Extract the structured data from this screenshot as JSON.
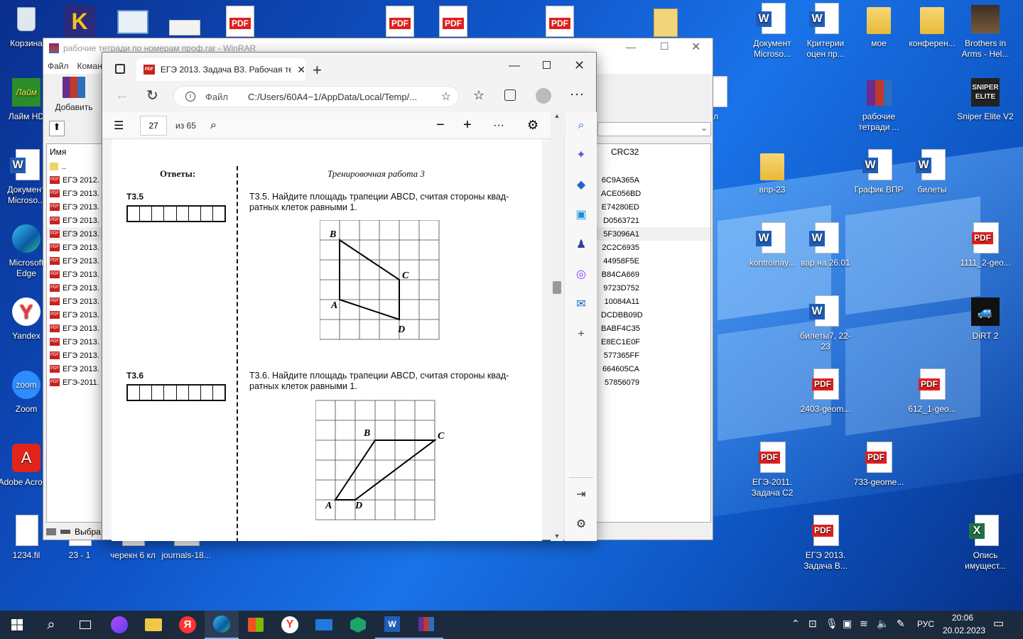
{
  "desktop_icons": [
    {
      "label": "Корзина",
      "type": "bin"
    },
    {
      "label": "Лайм HD",
      "type": "app",
      "color": "#2a8c2a",
      "text": "Лайм"
    },
    {
      "label": "Документ Microso...",
      "type": "word"
    },
    {
      "label": "Microsoft Edge",
      "type": "edge"
    },
    {
      "label": "Yandex",
      "type": "yandex"
    },
    {
      "label": "Zoom",
      "type": "zoom"
    },
    {
      "label": "Adobe Acrobat",
      "type": "acrobat"
    },
    {
      "label": "1234.fil",
      "type": "doc"
    },
    {
      "label": "23 - 1",
      "type": "doc"
    },
    {
      "label": "черекн 6 кл",
      "type": "doc"
    },
    {
      "label": "journals-18...",
      "type": "pdf"
    },
    {
      "label": "Документ Microso...",
      "type": "word"
    },
    {
      "label": "Критерии оцен пр...",
      "type": "word"
    },
    {
      "label": "мое",
      "type": "folder"
    },
    {
      "label": "конферен...",
      "type": "folder"
    },
    {
      "label": "Brothers in Arms - Hel...",
      "type": "game"
    },
    {
      "label": "кл",
      "type": "word"
    },
    {
      "label": "рабочие тетради ...",
      "type": "rar"
    },
    {
      "label": "Sniper Elite V2",
      "type": "sniper"
    },
    {
      "label": "впр-23",
      "type": "folder"
    },
    {
      "label": "График ВПР",
      "type": "word"
    },
    {
      "label": "билеты",
      "type": "word"
    },
    {
      "label": "kontrolnay...",
      "type": "word"
    },
    {
      "label": "вар на 26.01",
      "type": "word"
    },
    {
      "label": "1111_2-geo...",
      "type": "pdf"
    },
    {
      "label": "билеты7, 22-23",
      "type": "word"
    },
    {
      "label": "DiRT 2",
      "type": "dirt"
    },
    {
      "label": "2403-geom...",
      "type": "pdf"
    },
    {
      "label": "612_1-geo...",
      "type": "pdf"
    },
    {
      "label": "ЕГЭ-2011. Задача С2",
      "type": "pdf"
    },
    {
      "label": "733-geome...",
      "type": "pdf"
    },
    {
      "label": "ЕГЭ 2013. Задача В...",
      "type": "pdf"
    },
    {
      "label": "Опись имущест...",
      "type": "excel"
    }
  ],
  "top_icons": [
    "PDF",
    "PDF",
    "PDF",
    "PDF"
  ],
  "winrar": {
    "title": "рабочие тетради по номерам проф.rar - WinRAR",
    "menu": [
      "Файл",
      "Коман"
    ],
    "add_label": "Добавить",
    "col_name": "Имя",
    "col_crc": "CRC32",
    "status": "Выбра",
    "rows": [
      {
        "name": "..",
        "crc": ""
      },
      {
        "name": "ЕГЭ 2012.  3",
        "crc": "6C9A365A"
      },
      {
        "name": "ЕГЭ 2013.  3",
        "crc": "ACE056BD"
      },
      {
        "name": "ЕГЭ 2013.  3",
        "crc": "E74280ED"
      },
      {
        "name": "ЕГЭ 2013.  3",
        "crc": "D0563721"
      },
      {
        "name": "ЕГЭ 2013.  3",
        "crc": "5F3096A1"
      },
      {
        "name": "ЕГЭ 2013.  3",
        "crc": "2C2C6935"
      },
      {
        "name": "ЕГЭ 2013.  3",
        "crc": "44958F5E"
      },
      {
        "name": "ЕГЭ 2013.  3",
        "crc": "B84CA669"
      },
      {
        "name": "ЕГЭ 2013.  3",
        "crc": "9723D752"
      },
      {
        "name": "ЕГЭ 2013.  3",
        "crc": "10084A11"
      },
      {
        "name": "ЕГЭ 2013.  3",
        "crc": "DCDBB09D"
      },
      {
        "name": "ЕГЭ 2013.  3",
        "crc": "BABF4C35"
      },
      {
        "name": "ЕГЭ 2013.  3",
        "crc": "E8EC1E0F"
      },
      {
        "name": "ЕГЭ 2013.  3",
        "crc": "577365FF"
      },
      {
        "name": "ЕГЭ 2013.  3",
        "crc": "664605CA"
      },
      {
        "name": "ЕГЭ-2011.  3",
        "crc": "57856079"
      }
    ]
  },
  "edge": {
    "tab_title": "ЕГЭ 2013. Задача В3. Рабочая те",
    "addr_label": "Файл",
    "addr_url": "C:/Users/60A4~1/AppData/Local/Temp/...",
    "page_num": "27",
    "page_total": "из 65"
  },
  "pdf": {
    "answers_head": "Ответы:",
    "section_head": "Тренировочная работа 3",
    "t35_label": "Т3.5",
    "t35_text": "Т3.5. Найдите площадь трапеции ABCD, считая стороны квад-ратных клеток равными 1.",
    "t36_label": "Т3.6",
    "t36_text": "Т3.6. Найдите площадь трапеции ABCD, считая стороны квад-ратных клеток равными 1.",
    "pts": [
      "B",
      "C",
      "A",
      "D"
    ]
  },
  "taskbar": {
    "lang": "РУС",
    "time": "20:06",
    "date": "20.02.2023"
  }
}
